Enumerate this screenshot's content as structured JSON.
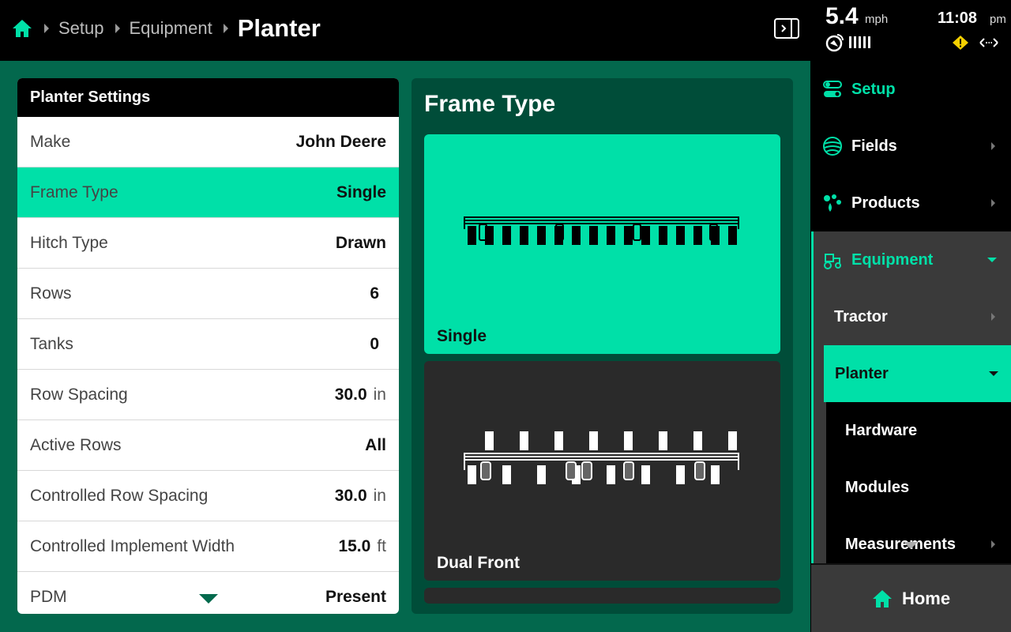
{
  "breadcrumb": {
    "items": [
      "Setup",
      "Equipment"
    ],
    "current": "Planter"
  },
  "status": {
    "speed": "5.4",
    "speed_unit": "mph",
    "time": "11:08",
    "ampm": "pm"
  },
  "settings": {
    "title": "Planter Settings",
    "rows": [
      {
        "label": "Make",
        "value": "John Deere",
        "unit": ""
      },
      {
        "label": "Frame Type",
        "value": "Single",
        "unit": ""
      },
      {
        "label": "Hitch Type",
        "value": "Drawn",
        "unit": ""
      },
      {
        "label": "Rows",
        "value": "6",
        "unit": ""
      },
      {
        "label": "Tanks",
        "value": "0",
        "unit": ""
      },
      {
        "label": "Row Spacing",
        "value": "30.0",
        "unit": "in"
      },
      {
        "label": "Active Rows",
        "value": "All",
        "unit": ""
      },
      {
        "label": "Controlled Row Spacing",
        "value": "30.0",
        "unit": "in"
      },
      {
        "label": "Controlled Implement Width",
        "value": "15.0",
        "unit": "ft"
      },
      {
        "label": "PDM",
        "value": "Present",
        "unit": ""
      }
    ]
  },
  "frame": {
    "title": "Frame Type",
    "options": [
      "Single",
      "Dual Front"
    ]
  },
  "nav": {
    "setup": "Setup",
    "fields": "Fields",
    "products": "Products",
    "equipment": "Equipment",
    "tractor": "Tractor",
    "planter": "Planter",
    "hardware": "Hardware",
    "modules": "Modules",
    "measurements": "Measurements",
    "home": "Home"
  },
  "colors": {
    "accent": "#00e0a8",
    "background": "#03684d",
    "panel": "#004d39"
  },
  "icons": [
    "home-icon",
    "panel-toggle-icon",
    "gps-icon",
    "signal-bars-icon",
    "warning-icon",
    "link-icon",
    "setup-icon",
    "fields-icon",
    "products-icon",
    "equipment-icon"
  ]
}
